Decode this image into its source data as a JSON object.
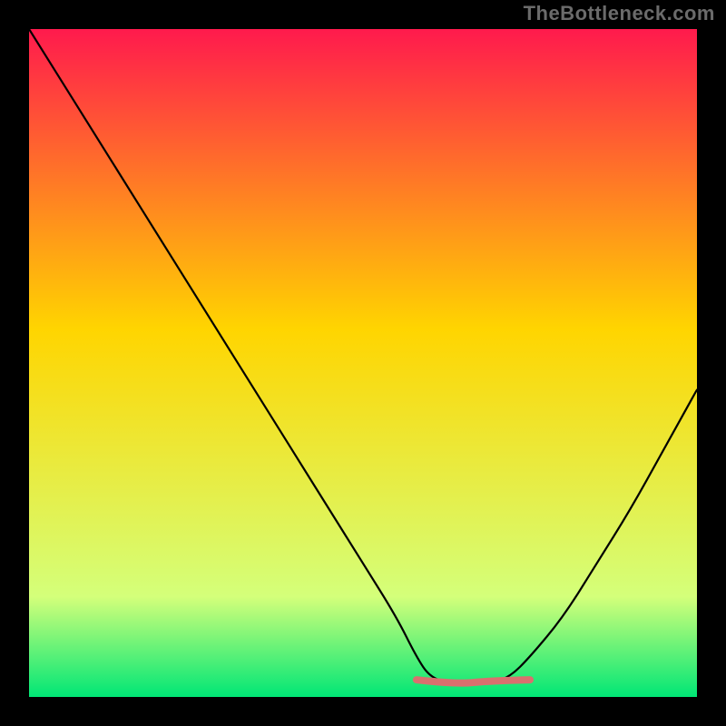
{
  "attribution": "TheBottleneck.com",
  "colors": {
    "frame": "#000000",
    "attribution_text": "#6b6b6b",
    "gradient_top": "#ff1a4d",
    "gradient_mid": "#ffd500",
    "gradient_low": "#d4ff7a",
    "gradient_bottom": "#00e676",
    "curve": "#000000",
    "highlight": "#d9706e"
  },
  "chart_data": {
    "type": "line",
    "title": "",
    "xlabel": "",
    "ylabel": "",
    "xlim": [
      0,
      100
    ],
    "ylim": [
      0,
      100
    ],
    "legend": "none",
    "series": [
      {
        "name": "bottleneck-curve",
        "x": [
          0,
          5,
          10,
          15,
          20,
          25,
          30,
          35,
          40,
          45,
          50,
          55,
          58,
          60,
          63,
          66,
          69,
          72,
          75,
          80,
          85,
          90,
          95,
          100
        ],
        "y": [
          100,
          92,
          84,
          76,
          68,
          60,
          52,
          44,
          36,
          28,
          20,
          12,
          6,
          3,
          2,
          2,
          2,
          3,
          6,
          12,
          20,
          28,
          37,
          46
        ]
      }
    ],
    "highlight_region": {
      "x_start": 58,
      "x_end": 75,
      "y": 2
    },
    "gradient_stops": [
      {
        "offset": 0.0,
        "color": "#ff1a4d"
      },
      {
        "offset": 0.45,
        "color": "#ffd500"
      },
      {
        "offset": 0.85,
        "color": "#d4ff7a"
      },
      {
        "offset": 1.0,
        "color": "#00e676"
      }
    ]
  }
}
